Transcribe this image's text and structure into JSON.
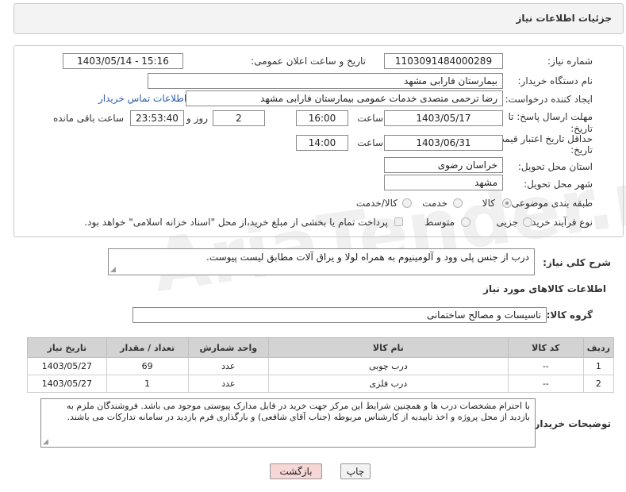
{
  "header": {
    "title": "جزئیات اطلاعات نیاز"
  },
  "form": {
    "need_number_label": "شماره نیاز:",
    "need_number": "1103091484000289",
    "announce_label": "تاریخ و ساعت اعلان عمومی:",
    "announce_value": "1403/05/14 - 15:16",
    "buyer_org_label": "نام دستگاه خریدار:",
    "buyer_org": "بیمارستان فارابی مشهد",
    "creator_label": "ایجاد کننده درخواست:",
    "creator": "رضا ترحمی متصدی خدمات عمومی بیمارستان فارابی مشهد",
    "contact_link": "اطلاعات تماس خریدار",
    "deadline_label_1": "مهلت ارسال پاسخ: تا",
    "deadline_label_2": "تاریخ:",
    "deadline_date": "1403/05/17",
    "time_label": "ساعت",
    "deadline_time": "16:00",
    "days_value": "2",
    "days_label": "روز و",
    "remaining_value": "23:53:40",
    "remaining_label": "ساعت باقی مانده",
    "validity_label_1": "حداقل تاریخ اعتبار قیمت: تا",
    "validity_label_2": "تاریخ:",
    "validity_date": "1403/06/31",
    "validity_time": "14:00",
    "province_label": "استان محل تحویل:",
    "province": "خراسان رضوی",
    "city_label": "شهر محل تحویل:",
    "city": "مشهد",
    "category_label": "طبقه بندی موضوعی:",
    "category_options": [
      "کالا",
      "خدمت",
      "کالا/خدمت"
    ],
    "category_selected": "کالا",
    "purchase_type_label": "نوع فرآیند خرید :",
    "purchase_options": [
      "جزیی",
      "متوسط"
    ],
    "payment_note": "پرداخت تمام یا بخشی از مبلغ خرید،از محل \"اسناد خزانه اسلامی\" خواهد بود."
  },
  "description": {
    "label": "شرح کلی نیاز:",
    "text": "درب از جنس پلی وود و آلومینیوم به همراه لولا و یراق آلات مطابق لیست پیوست."
  },
  "goods": {
    "section_title": "اطلاعات کالاهای مورد نیاز",
    "group_label": "گروه کالا:",
    "group_value": "تاسیسات و مصالح ساختمانی",
    "columns": [
      "ردیف",
      "کد کالا",
      "نام کالا",
      "واحد شمارش",
      "تعداد / مقدار",
      "تاریخ نیاز"
    ],
    "rows": [
      [
        "1",
        "--",
        "درب چوبی",
        "عدد",
        "69",
        "1403/05/27"
      ],
      [
        "2",
        "--",
        "درب فلزی",
        "عدد",
        "1",
        "1403/05/27"
      ]
    ]
  },
  "buyer_notes": {
    "label": "توضیحات خریدار:",
    "text": "با احترام مشخصات درب ها و همچنین شرایط این مرکز جهت خرید در فایل مدارک پیوستی موجود می باشد. فروشندگان ملزم به بازدید از محل پروژه و اخذ تاییدیه از کارشناس مربوطه (جناب آقای شافعی) و بارگذاری فرم بازدید در سامانه تدارکات می باشند."
  },
  "buttons": {
    "print": "چاپ",
    "back": "بازگشت"
  },
  "watermark": {
    "text": "AriaTender.net"
  },
  "colors": {
    "link": "#2a5db0",
    "back_button_bg": "#f7d6d6",
    "header_bg": "#f3f3f3"
  }
}
